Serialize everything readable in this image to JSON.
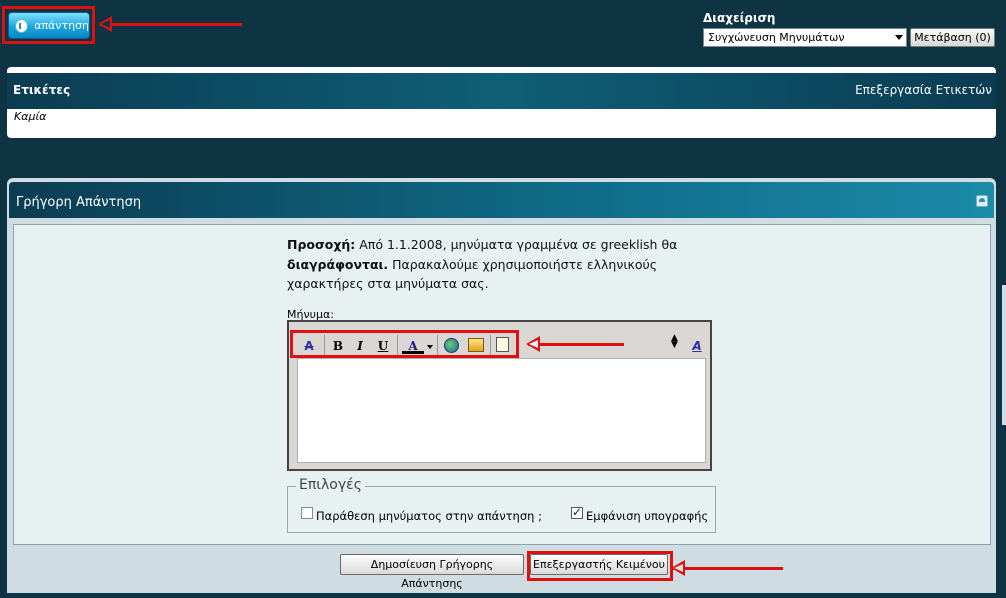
{
  "top": {
    "reply_label": "απάντηση",
    "admin_title": "Διαχείριση",
    "admin_selected": "Συγχώνευση Μηνυμάτων",
    "go_label": "Μετάβαση (0)"
  },
  "tags": {
    "title": "Ετικέτες",
    "edit_label": "Επεξεργασία Ετικετών",
    "value": "Καμία"
  },
  "quick_reply": {
    "title": "Γρήγορη Απάντηση",
    "warning_bold1": "Προσοχή:",
    "warning_text1": " Από 1.1.2008, μηνύματα γραμμένα σε greeklish θα ",
    "warning_bold2": "διαγράφονται.",
    "warning_text2": " Παρακαλούμε χρησιμοποιήστε ελληνικούς χαρακτήρες στα μηνύματα σας.",
    "message_label": "Μήνυμα:",
    "options_legend": "Επιλογές",
    "option_quote": "Παράθεση μηνύματος στην απάντηση ;",
    "option_quote_checked": false,
    "option_signature": "Εμφάνιση υπογραφής",
    "option_signature_checked": true,
    "post_button": "Δημοσίευση Γρήγορης Απάντησης",
    "editor_button": "Επεξεργαστής Κειμένου"
  },
  "toolbar": {
    "remove_format_icon": "A",
    "bold": "B",
    "italic": "I",
    "underline": "U",
    "font_color": "A",
    "resize_icon": "A"
  },
  "colors": {
    "background": "#0e3444",
    "highlight": "#e01010",
    "header_gradient": "#0e5f77"
  }
}
